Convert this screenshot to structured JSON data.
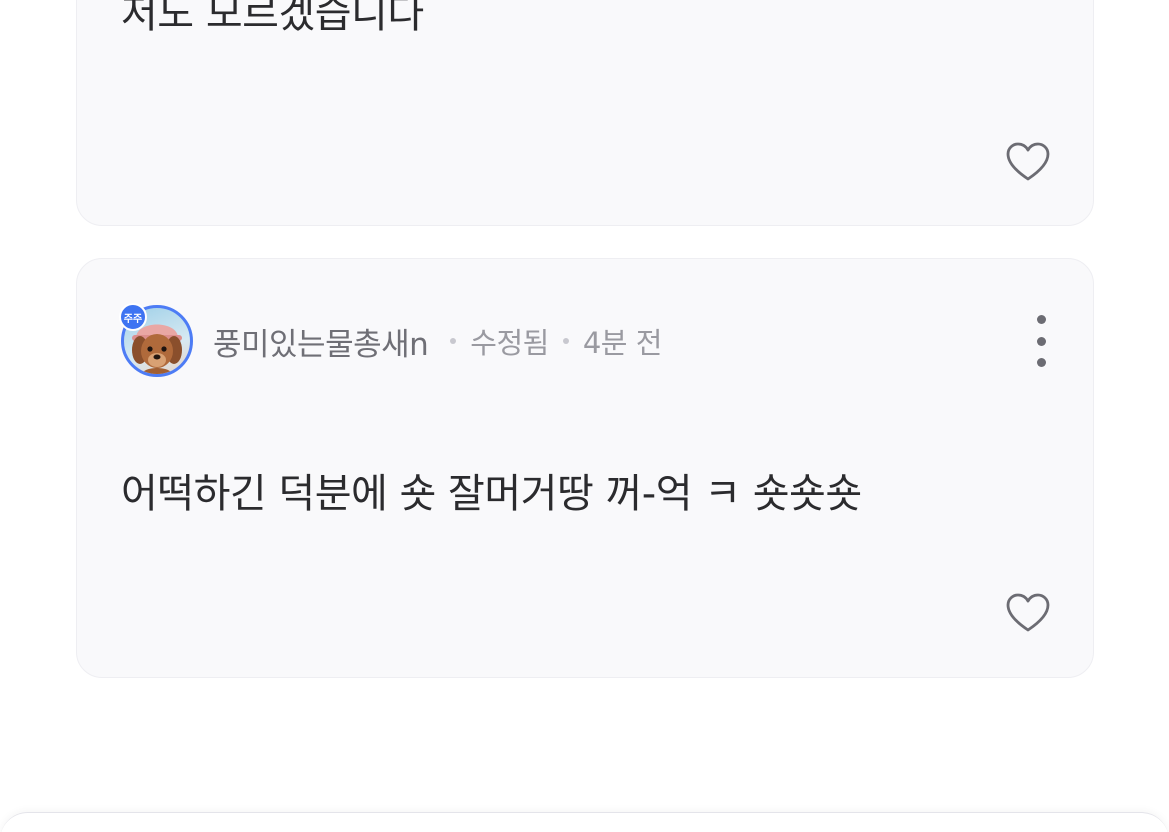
{
  "comments": [
    {
      "text": "저도 모르겠습니다",
      "like_icon": "heart-outline-icon"
    },
    {
      "author": "풍미있는물총새n",
      "badge": "주주",
      "edited_label": "수정됨",
      "time": "4분 전",
      "text": "어떡하긴 덕분에 숏 잘머거땅 꺼-억 ㅋ 숏숏숏",
      "like_icon": "heart-outline-icon",
      "more_icon": "more-vertical-icon"
    }
  ],
  "colors": {
    "card_background": "#f9f9fb",
    "avatar_border": "#4d7cf5",
    "badge": "#3e74f2",
    "text_primary": "#2b2b2e",
    "text_secondary": "#6f6f76",
    "text_meta": "#9a9aa1"
  }
}
